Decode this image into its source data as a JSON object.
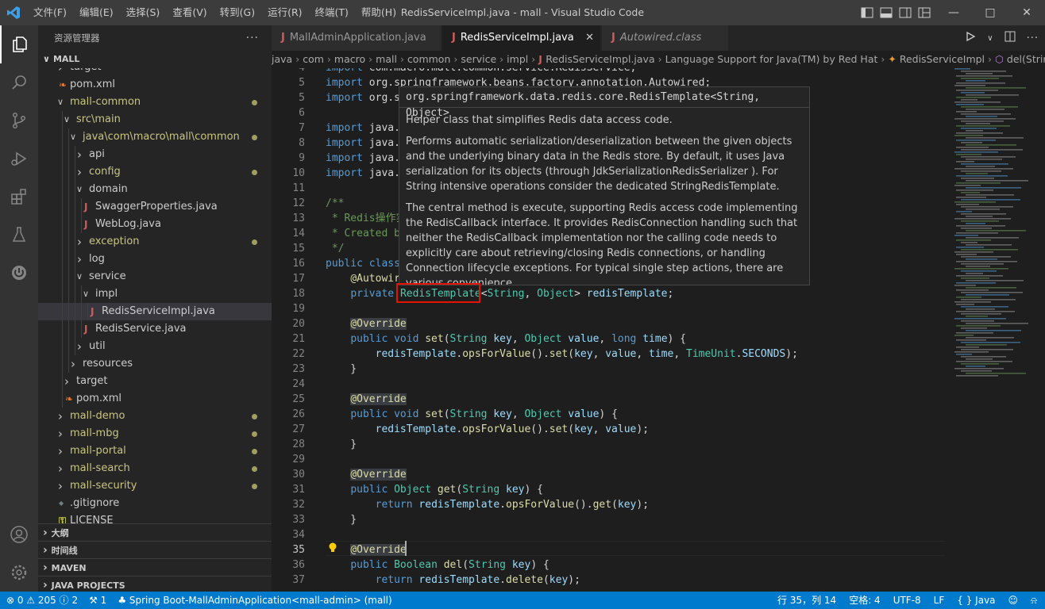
{
  "titlebar": {
    "menus": [
      "文件(F)",
      "编辑(E)",
      "选择(S)",
      "查看(V)",
      "转到(G)",
      "运行(R)",
      "终端(T)",
      "帮助(H)"
    ],
    "title": "RedisServiceImpl.java - mall - Visual Studio Code"
  },
  "sidebar": {
    "header": "资源管理器",
    "more": "···",
    "root": "MALL",
    "tree": [
      {
        "label": "target",
        "depth": 1,
        "type": "folder",
        "partial": true
      },
      {
        "label": "pom.xml",
        "depth": 1,
        "type": "xml"
      },
      {
        "label": "mall-common",
        "depth": 1,
        "type": "folder",
        "open": true,
        "color": "#c9c580",
        "dot": true
      },
      {
        "label": "src\\main",
        "depth": 2,
        "type": "folder",
        "open": true,
        "color": "#c9c580"
      },
      {
        "label": "java\\com\\macro\\mall\\common",
        "depth": 3,
        "type": "folder",
        "open": true,
        "color": "#c9c580",
        "dot": true
      },
      {
        "label": "api",
        "depth": 4,
        "type": "folder"
      },
      {
        "label": "config",
        "depth": 4,
        "type": "folder",
        "color": "#c9c580",
        "dot": true
      },
      {
        "label": "domain",
        "depth": 4,
        "type": "folder",
        "open": true
      },
      {
        "label": "SwaggerProperties.java",
        "depth": 5,
        "type": "java"
      },
      {
        "label": "WebLog.java",
        "depth": 5,
        "type": "java"
      },
      {
        "label": "exception",
        "depth": 4,
        "type": "folder",
        "color": "#c9c580",
        "dot": true
      },
      {
        "label": "log",
        "depth": 4,
        "type": "folder"
      },
      {
        "label": "service",
        "depth": 4,
        "type": "folder",
        "open": true
      },
      {
        "label": "impl",
        "depth": 5,
        "type": "folder",
        "open": true
      },
      {
        "label": "RedisServiceImpl.java",
        "depth": 6,
        "type": "java",
        "selected": true
      },
      {
        "label": "RedisService.java",
        "depth": 5,
        "type": "java"
      },
      {
        "label": "util",
        "depth": 4,
        "type": "folder"
      },
      {
        "label": "resources",
        "depth": 3,
        "type": "folder"
      },
      {
        "label": "target",
        "depth": 2,
        "type": "folder"
      },
      {
        "label": "pom.xml",
        "depth": 2,
        "type": "xml"
      },
      {
        "label": "mall-demo",
        "depth": 1,
        "type": "folder",
        "color": "#c9c580",
        "dot": true
      },
      {
        "label": "mall-mbg",
        "depth": 1,
        "type": "folder",
        "color": "#c9c580",
        "dot": true
      },
      {
        "label": "mall-portal",
        "depth": 1,
        "type": "folder",
        "color": "#c9c580",
        "dot": true
      },
      {
        "label": "mall-search",
        "depth": 1,
        "type": "folder",
        "color": "#c9c580",
        "dot": true
      },
      {
        "label": "mall-security",
        "depth": 1,
        "type": "folder",
        "color": "#c9c580",
        "dot": true
      },
      {
        "label": ".gitignore",
        "depth": 1,
        "type": "git"
      },
      {
        "label": "LICENSE",
        "depth": 1,
        "type": "license",
        "partial": true
      }
    ],
    "sections": [
      "大纲",
      "时间线",
      "MAVEN",
      "JAVA PROJECTS"
    ]
  },
  "tabs": [
    {
      "label": "MallAdminApplication.java",
      "italic": false
    },
    {
      "label": "RedisServiceImpl.java",
      "active": true,
      "close": "✕"
    },
    {
      "label": "Autowired.class",
      "italic": true
    }
  ],
  "breadcrumb": [
    "java",
    "com",
    "macro",
    "mall",
    "common",
    "service",
    "impl",
    "RedisServiceImpl.java",
    "Language Support for Java(TM) by Red Hat",
    "RedisServiceImpl",
    "del(String)"
  ],
  "editor": {
    "current_line": 35,
    "lines": [
      {
        "n": "4",
        "t": [
          [
            "kw",
            "import "
          ],
          [
            "pl",
            "com.macro.mall.common.service.RedisService;"
          ]
        ]
      },
      {
        "n": "5",
        "t": [
          [
            "kw",
            "import "
          ],
          [
            "pl",
            "org.springframework.beans.factory.annotation.Autowired;"
          ]
        ]
      },
      {
        "n": "5",
        "t": [
          [
            "kw",
            "import "
          ],
          [
            "pl",
            "org.s"
          ]
        ]
      },
      {
        "n": "6",
        "t": []
      },
      {
        "n": "7",
        "t": [
          [
            "kw",
            "import "
          ],
          [
            "pl",
            "java."
          ]
        ]
      },
      {
        "n": "8",
        "t": [
          [
            "kw",
            "import "
          ],
          [
            "pl",
            "java."
          ]
        ]
      },
      {
        "n": "9",
        "t": [
          [
            "kw",
            "import "
          ],
          [
            "pl",
            "java."
          ]
        ]
      },
      {
        "n": "10",
        "t": [
          [
            "kw",
            "import "
          ],
          [
            "pl",
            "java."
          ]
        ]
      },
      {
        "n": "11",
        "t": []
      },
      {
        "n": "12",
        "t": [
          [
            "cm",
            "/**"
          ]
        ]
      },
      {
        "n": "13",
        "t": [
          [
            "cm",
            " * Redis操作实"
          ]
        ]
      },
      {
        "n": "14",
        "t": [
          [
            "cm",
            " * Created b"
          ]
        ]
      },
      {
        "n": "15",
        "t": [
          [
            "cm",
            " */"
          ]
        ]
      },
      {
        "n": "16",
        "t": [
          [
            "kw",
            "public class"
          ]
        ]
      },
      {
        "n": "17",
        "t": [
          [
            "pl",
            "    "
          ],
          [
            "an",
            "@Autowired"
          ]
        ]
      },
      {
        "n": "18",
        "t": [
          [
            "pl",
            "    "
          ],
          [
            "kw",
            "private "
          ],
          [
            "ty",
            "RedisTemplate"
          ],
          [
            "pl",
            "<"
          ],
          [
            "ty",
            "String"
          ],
          [
            "pl",
            ", "
          ],
          [
            "ty",
            "Object"
          ],
          [
            "pl",
            "> "
          ],
          [
            "pm",
            "redisTemplate"
          ],
          [
            "pl",
            ";"
          ]
        ]
      },
      {
        "n": "19",
        "t": []
      },
      {
        "n": "20",
        "t": [
          [
            "pl",
            "    "
          ],
          [
            "an",
            "@Override"
          ]
        ]
      },
      {
        "n": "21",
        "t": [
          [
            "pl",
            "    "
          ],
          [
            "kw",
            "public void "
          ],
          [
            "fn",
            "set"
          ],
          [
            "pl",
            "("
          ],
          [
            "ty",
            "String "
          ],
          [
            "pm",
            "key"
          ],
          [
            "pl",
            ", "
          ],
          [
            "ty",
            "Object "
          ],
          [
            "pm",
            "value"
          ],
          [
            "pl",
            ", "
          ],
          [
            "kw",
            "long "
          ],
          [
            "pm",
            "time"
          ],
          [
            "pl",
            ") {"
          ]
        ]
      },
      {
        "n": "22",
        "t": [
          [
            "pl",
            "        "
          ],
          [
            "pm",
            "redisTemplate"
          ],
          [
            "pl",
            "."
          ],
          [
            "fn",
            "opsForValue"
          ],
          [
            "pl",
            "()."
          ],
          [
            "fn",
            "set"
          ],
          [
            "pl",
            "("
          ],
          [
            "pm",
            "key"
          ],
          [
            "pl",
            ", "
          ],
          [
            "pm",
            "value"
          ],
          [
            "pl",
            ", "
          ],
          [
            "pm",
            "time"
          ],
          [
            "pl",
            ", "
          ],
          [
            "ty",
            "TimeUnit"
          ],
          [
            "pl",
            "."
          ],
          [
            "pm",
            "SECONDS"
          ],
          [
            "pl",
            ");"
          ]
        ]
      },
      {
        "n": "23",
        "t": [
          [
            "pl",
            "    }"
          ]
        ]
      },
      {
        "n": "24",
        "t": []
      },
      {
        "n": "25",
        "t": [
          [
            "pl",
            "    "
          ],
          [
            "an",
            "@Override"
          ]
        ]
      },
      {
        "n": "26",
        "t": [
          [
            "pl",
            "    "
          ],
          [
            "kw",
            "public void "
          ],
          [
            "fn",
            "set"
          ],
          [
            "pl",
            "("
          ],
          [
            "ty",
            "String "
          ],
          [
            "pm",
            "key"
          ],
          [
            "pl",
            ", "
          ],
          [
            "ty",
            "Object "
          ],
          [
            "pm",
            "value"
          ],
          [
            "pl",
            ") {"
          ]
        ]
      },
      {
        "n": "27",
        "t": [
          [
            "pl",
            "        "
          ],
          [
            "pm",
            "redisTemplate"
          ],
          [
            "pl",
            "."
          ],
          [
            "fn",
            "opsForValue"
          ],
          [
            "pl",
            "()."
          ],
          [
            "fn",
            "set"
          ],
          [
            "pl",
            "("
          ],
          [
            "pm",
            "key"
          ],
          [
            "pl",
            ", "
          ],
          [
            "pm",
            "value"
          ],
          [
            "pl",
            ");"
          ]
        ]
      },
      {
        "n": "28",
        "t": [
          [
            "pl",
            "    }"
          ]
        ]
      },
      {
        "n": "29",
        "t": []
      },
      {
        "n": "30",
        "t": [
          [
            "pl",
            "    "
          ],
          [
            "an",
            "@Override"
          ]
        ]
      },
      {
        "n": "31",
        "t": [
          [
            "pl",
            "    "
          ],
          [
            "kw",
            "public "
          ],
          [
            "ty",
            "Object "
          ],
          [
            "fn",
            "get"
          ],
          [
            "pl",
            "("
          ],
          [
            "ty",
            "String "
          ],
          [
            "pm",
            "key"
          ],
          [
            "pl",
            ") {"
          ]
        ]
      },
      {
        "n": "32",
        "t": [
          [
            "pl",
            "        "
          ],
          [
            "kw",
            "return "
          ],
          [
            "pm",
            "redisTemplate"
          ],
          [
            "pl",
            "."
          ],
          [
            "fn",
            "opsForValue"
          ],
          [
            "pl",
            "()."
          ],
          [
            "fn",
            "get"
          ],
          [
            "pl",
            "("
          ],
          [
            "pm",
            "key"
          ],
          [
            "pl",
            ");"
          ]
        ]
      },
      {
        "n": "33",
        "t": [
          [
            "pl",
            "    }"
          ]
        ]
      },
      {
        "n": "34",
        "t": []
      },
      {
        "n": "35",
        "t": [
          [
            "pl",
            "    "
          ],
          [
            "an",
            "@Override"
          ]
        ]
      },
      {
        "n": "36",
        "t": [
          [
            "pl",
            "    "
          ],
          [
            "kw",
            "public "
          ],
          [
            "ty",
            "Boolean "
          ],
          [
            "fn",
            "del"
          ],
          [
            "pl",
            "("
          ],
          [
            "ty",
            "String "
          ],
          [
            "pm",
            "key"
          ],
          [
            "pl",
            ") {"
          ]
        ]
      },
      {
        "n": "37",
        "t": [
          [
            "pl",
            "        "
          ],
          [
            "kw",
            "return "
          ],
          [
            "pm",
            "redisTemplate"
          ],
          [
            "pl",
            "."
          ],
          [
            "fn",
            "delete"
          ],
          [
            "pl",
            "("
          ],
          [
            "pm",
            "key"
          ],
          [
            "pl",
            ");"
          ]
        ]
      }
    ]
  },
  "hover": {
    "signature": "org.springframework.data.redis.core.RedisTemplate<String, Object>",
    "paragraphs": [
      "Helper class that simplifies Redis data access code.",
      "Performs automatic serialization/deserialization between the given objects and the underlying binary data in the Redis store. By default, it uses Java serialization for its objects (through JdkSerializationRedisSerializer ). For String intensive operations consider the dedicated StringRedisTemplate.",
      "The central method is execute, supporting Redis access code implementing the RedisCallback interface. It provides RedisConnection handling such that neither the RedisCallback implementation nor the calling code needs to explicitly care about retrieving/closing Redis connections, or handling Connection lifecycle exceptions. For typical single step actions, there are various convenience"
    ]
  },
  "statusbar": {
    "errors": "0",
    "warnings": "205",
    "info": "2",
    "tools": "1",
    "spring": "Spring Boot-MallAdminApplication<mall-admin> (mall)",
    "position": "行 35，列 14",
    "spaces": "空格: 4",
    "encoding": "UTF-8",
    "eol": "LF",
    "language": "Java"
  },
  "colors": {
    "accent": "#007acc",
    "highlight_box": "#e51400"
  }
}
